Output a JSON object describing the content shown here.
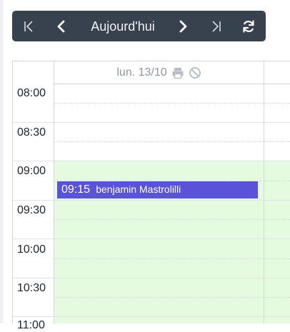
{
  "toolbar": {
    "today_label": "Aujourd'hui"
  },
  "day": {
    "header": "lun. 13/10"
  },
  "time_slots": [
    "08:00",
    "08:30",
    "09:00",
    "09:30",
    "10:00",
    "10:30",
    "11:00"
  ],
  "event": {
    "time": "09:15",
    "name": "benjamin Mastrolilli",
    "color": "#5a52d9"
  },
  "colors": {
    "toolbar_bg": "#38424f",
    "available_bg": "#e4fbe0"
  }
}
